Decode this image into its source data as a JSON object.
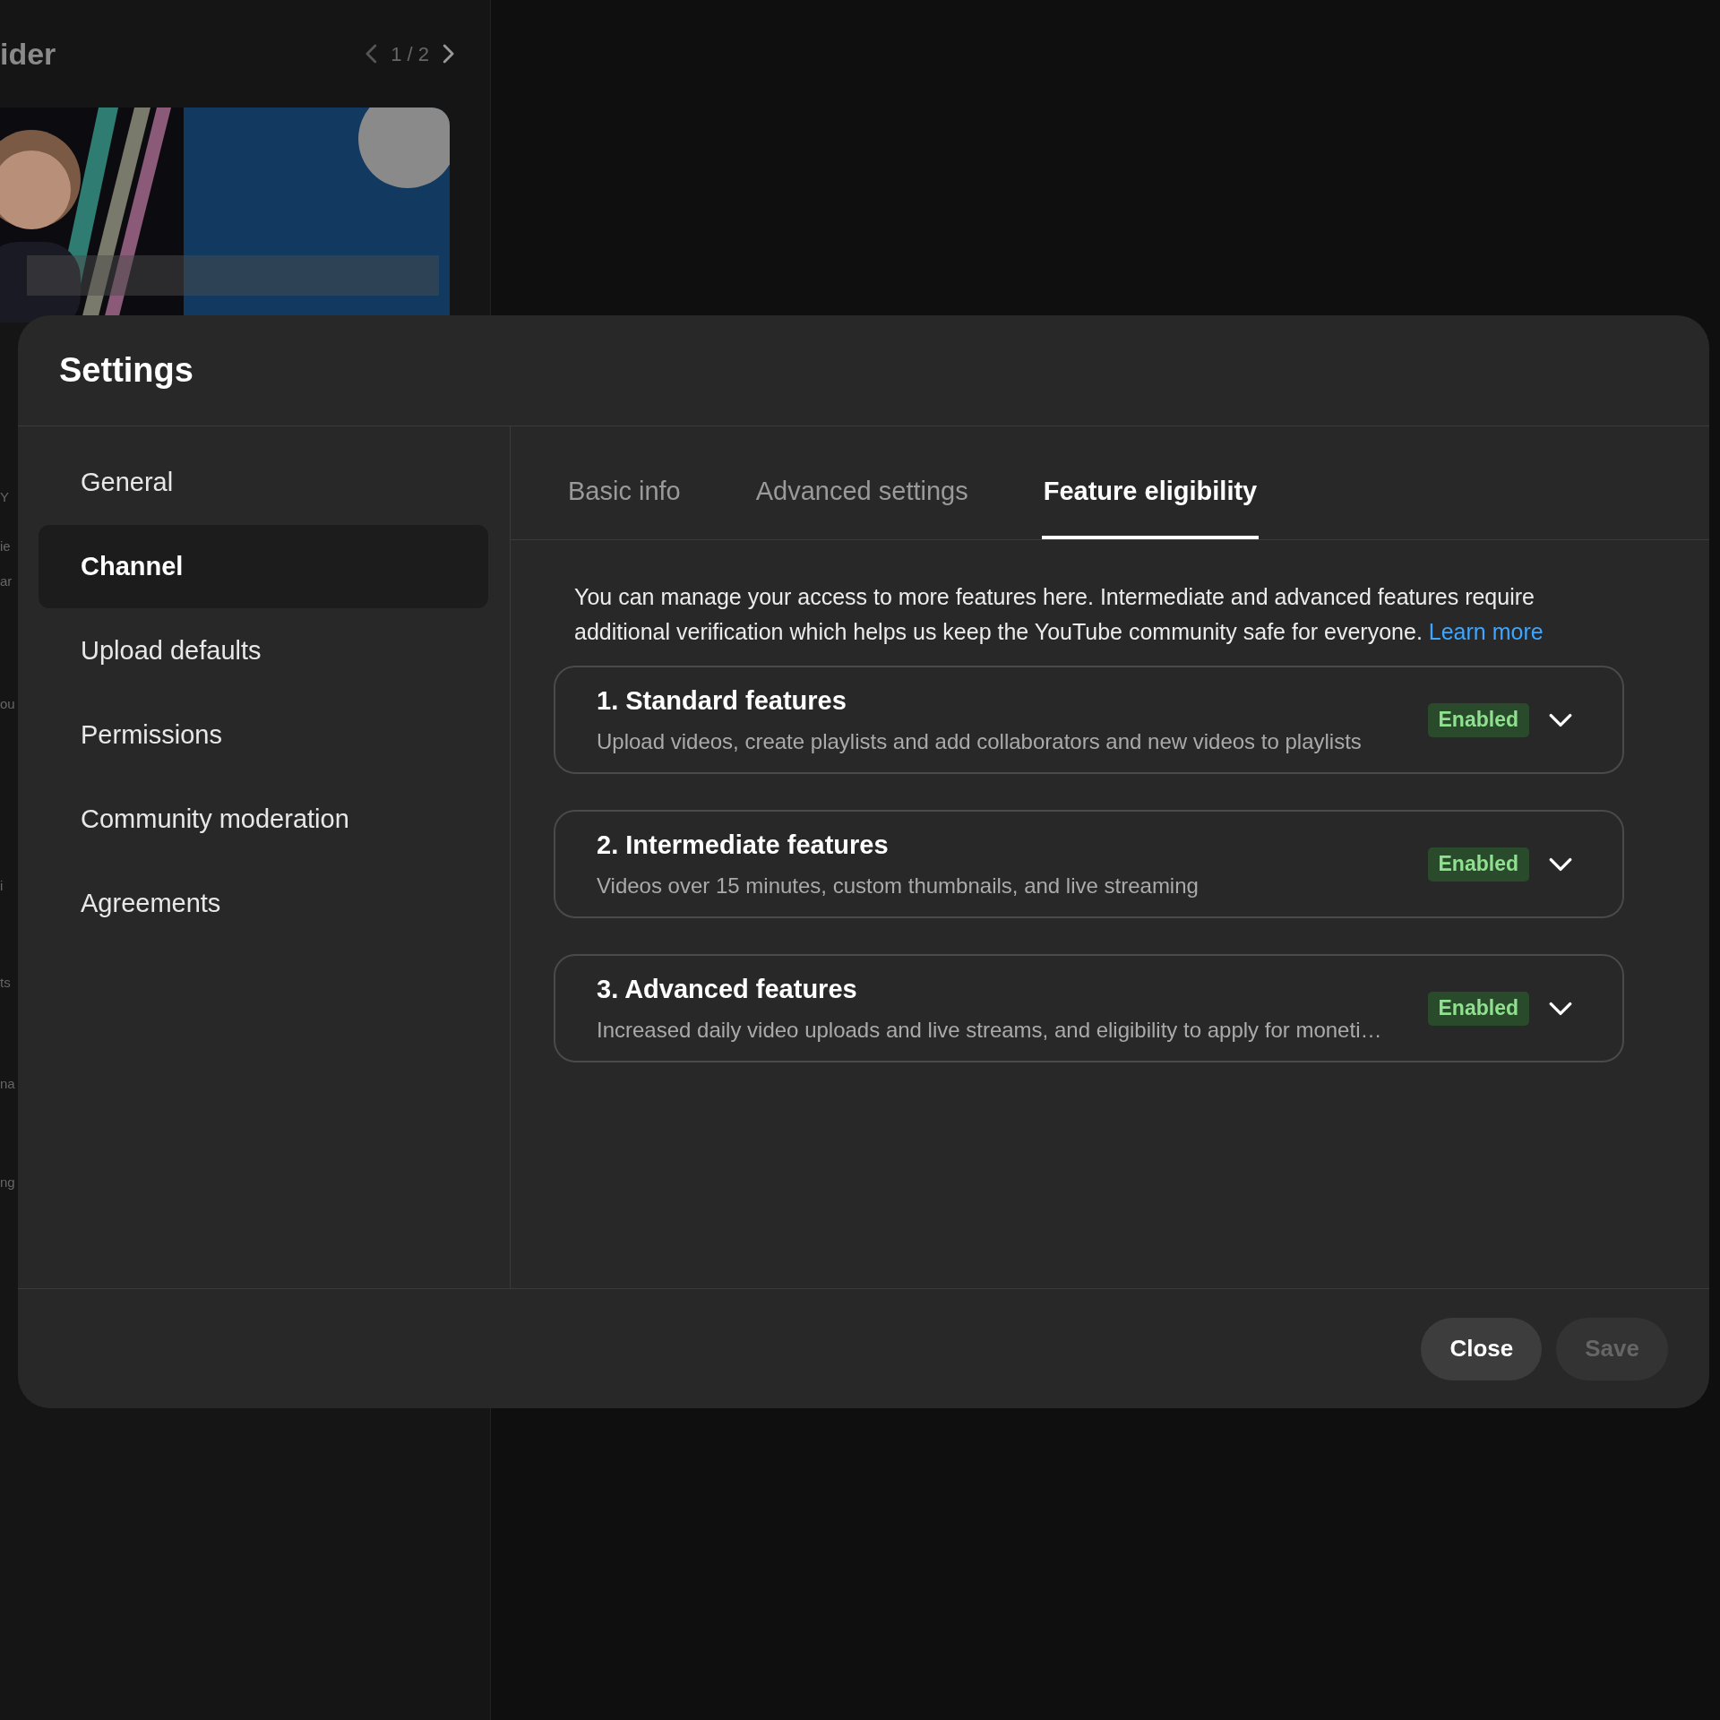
{
  "background": {
    "title": "ider",
    "pager": "1 / 2",
    "clipped_texts": [
      "Y",
      "ie",
      "ar",
      "ou",
      "i",
      "ts",
      "na",
      "ng"
    ]
  },
  "dialog": {
    "title": "Settings",
    "sidebar": [
      {
        "label": "General",
        "selected": false
      },
      {
        "label": "Channel",
        "selected": true
      },
      {
        "label": "Upload defaults",
        "selected": false
      },
      {
        "label": "Permissions",
        "selected": false
      },
      {
        "label": "Community moderation",
        "selected": false
      },
      {
        "label": "Agreements",
        "selected": false
      }
    ],
    "tabs": [
      {
        "label": "Basic info",
        "selected": false
      },
      {
        "label": "Advanced settings",
        "selected": false
      },
      {
        "label": "Feature eligibility",
        "selected": true
      }
    ],
    "description": "You can manage your access to more features here. Intermediate and advanced features require additional verification which helps us keep the YouTube community safe for everyone.",
    "learn_more": "Learn more",
    "features": [
      {
        "title": "1. Standard features",
        "description": "Upload videos, create playlists and add collaborators and new videos to playlists",
        "status": "Enabled"
      },
      {
        "title": "2. Intermediate features",
        "description": "Videos over 15 minutes, custom thumbnails, and live streaming",
        "status": "Enabled"
      },
      {
        "title": "3. Advanced features",
        "description": "Increased daily video uploads and live streams, and eligibility to apply for moneti…",
        "status": "Enabled"
      }
    ],
    "buttons": [
      {
        "label": "Close",
        "disabled": false
      },
      {
        "label": "Save",
        "disabled": true
      }
    ]
  }
}
